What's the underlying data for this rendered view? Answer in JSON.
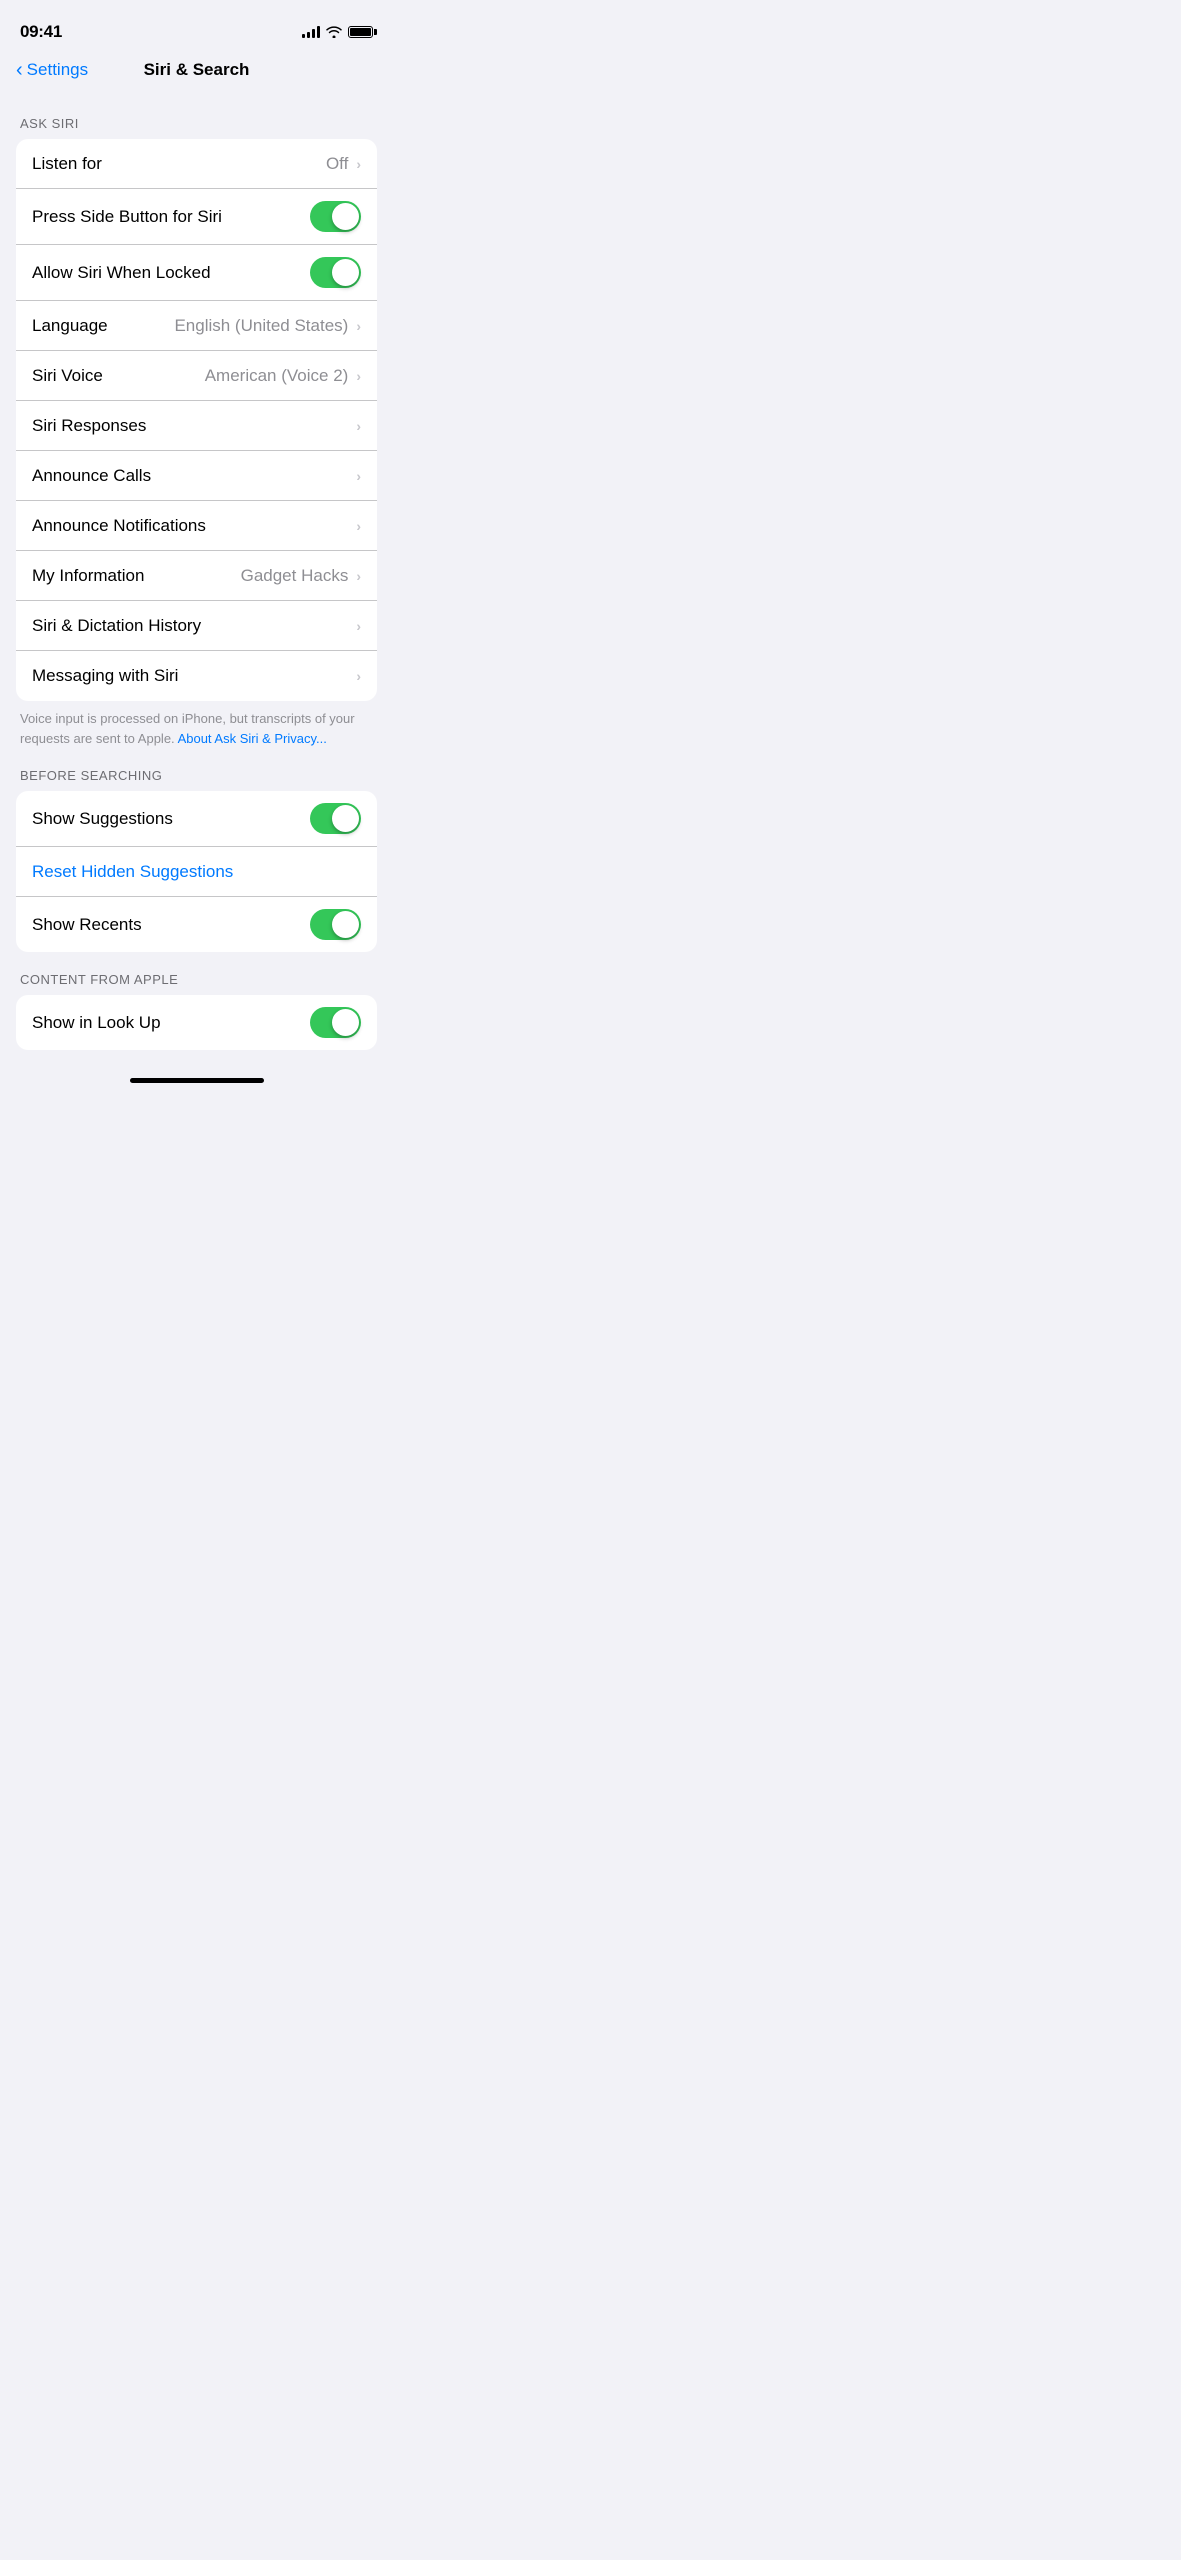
{
  "statusBar": {
    "time": "09:41",
    "signalBars": [
      4,
      6,
      8,
      10,
      12
    ],
    "batteryFull": true
  },
  "nav": {
    "backLabel": "Settings",
    "title": "Siri & Search"
  },
  "sections": {
    "askSiri": {
      "header": "ASK SIRI",
      "rows": [
        {
          "id": "listen-for",
          "label": "Listen for",
          "value": "Off",
          "type": "nav"
        },
        {
          "id": "press-side",
          "label": "Press Side Button for Siri",
          "value": "",
          "type": "toggle",
          "on": true
        },
        {
          "id": "allow-locked",
          "label": "Allow Siri When Locked",
          "value": "",
          "type": "toggle",
          "on": true
        },
        {
          "id": "language",
          "label": "Language",
          "value": "English (United States)",
          "type": "nav"
        },
        {
          "id": "siri-voice",
          "label": "Siri Voice",
          "value": "American (Voice 2)",
          "type": "nav"
        },
        {
          "id": "siri-responses",
          "label": "Siri Responses",
          "value": "",
          "type": "nav"
        },
        {
          "id": "announce-calls",
          "label": "Announce Calls",
          "value": "",
          "type": "nav"
        },
        {
          "id": "announce-notif",
          "label": "Announce Notifications",
          "value": "",
          "type": "nav"
        },
        {
          "id": "my-information",
          "label": "My Information",
          "value": "Gadget Hacks",
          "type": "nav"
        },
        {
          "id": "dictation-history",
          "label": "Siri & Dictation History",
          "value": "",
          "type": "nav"
        },
        {
          "id": "messaging-siri",
          "label": "Messaging with Siri",
          "value": "",
          "type": "nav"
        }
      ],
      "footer": "Voice input is processed on iPhone, but transcripts of your requests are sent to Apple. ",
      "footerLink": "About Ask Siri & Privacy...",
      "footerLinkHref": "#"
    },
    "beforeSearching": {
      "header": "BEFORE SEARCHING",
      "rows": [
        {
          "id": "show-suggestions",
          "label": "Show Suggestions",
          "value": "",
          "type": "toggle",
          "on": true
        },
        {
          "id": "reset-hidden",
          "label": "Reset Hidden Suggestions",
          "value": "",
          "type": "link"
        },
        {
          "id": "show-recents",
          "label": "Show Recents",
          "value": "",
          "type": "toggle",
          "on": true
        }
      ]
    },
    "contentFromApple": {
      "header": "CONTENT FROM APPLE",
      "rows": [
        {
          "id": "show-lookup",
          "label": "Show in Look Up",
          "value": "",
          "type": "toggle",
          "on": true
        }
      ]
    }
  }
}
